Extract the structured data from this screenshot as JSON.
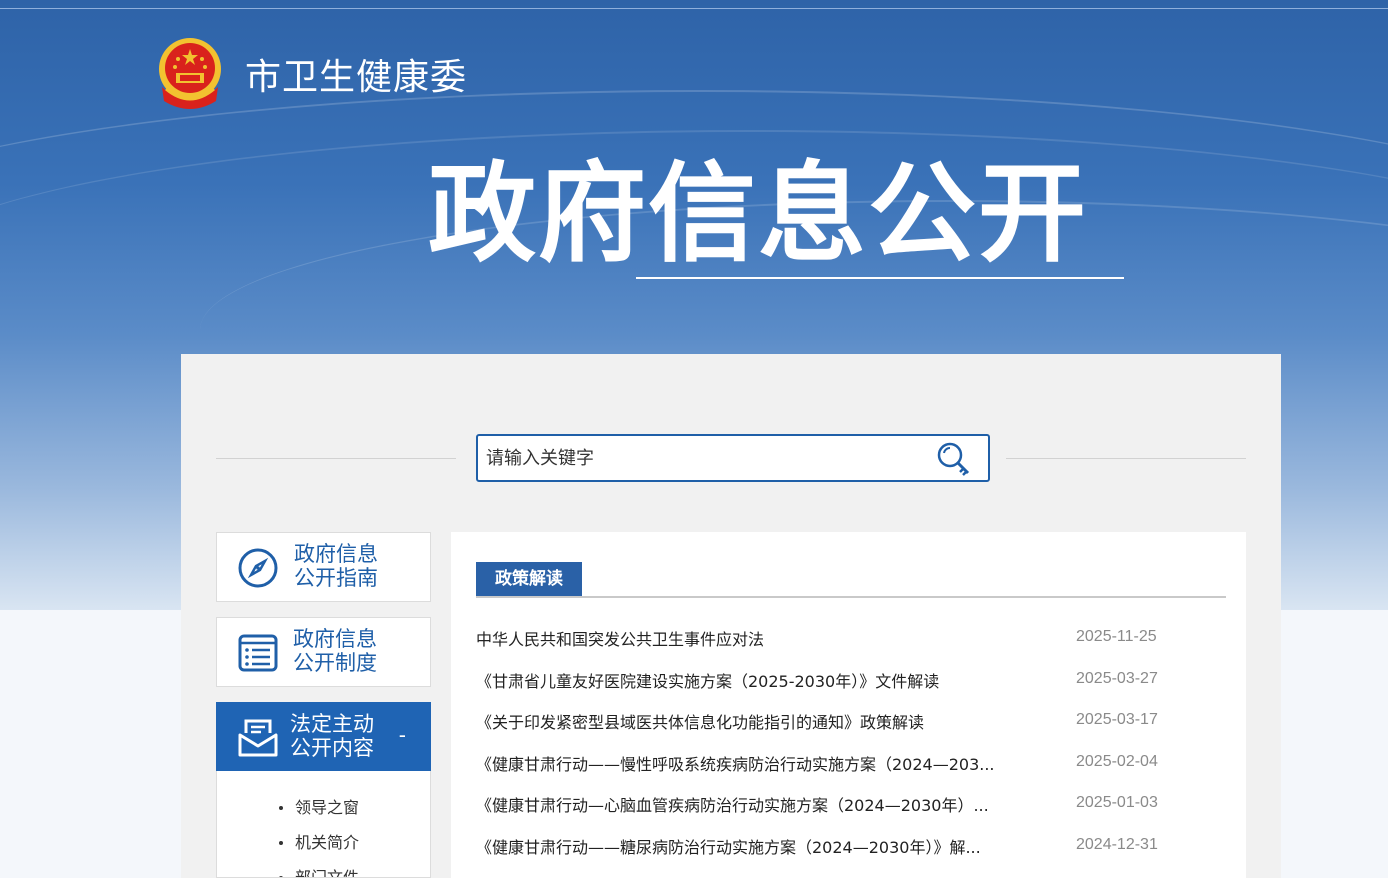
{
  "header": {
    "site_title": "市卫生健康委",
    "hero_title": "政府信息公开"
  },
  "search": {
    "placeholder": "请输入关键字"
  },
  "sidebar": {
    "items": [
      {
        "label_line1": "政府信息",
        "label_line2": "公开指南",
        "icon": "compass-icon"
      },
      {
        "label_line1": "政府信息",
        "label_line2": "公开制度",
        "icon": "document-list-icon"
      },
      {
        "label_line1": "法定主动",
        "label_line2": "公开内容",
        "icon": "mail-inbox-icon",
        "toggle": "-"
      }
    ],
    "subitems": [
      "领导之窗",
      "机关简介",
      "部门文件"
    ]
  },
  "content": {
    "section_title": "政策解读",
    "news": [
      {
        "title": "中华人民共和国突发公共卫生事件应对法",
        "date": "2025-11-25"
      },
      {
        "title": "《甘肃省儿童友好医院建设实施方案（2025-2030年）》文件解读",
        "date": "2025-03-27"
      },
      {
        "title": "《关于印发紧密型县域医共体信息化功能指引的通知》政策解读",
        "date": "2025-03-17"
      },
      {
        "title": "《健康甘肃行动——慢性呼吸系统疾病防治行动实施方案（2024—203...",
        "date": "2025-02-04"
      },
      {
        "title": "《健康甘肃行动—心脑血管疾病防治行动实施方案（2024—2030年）...",
        "date": "2025-01-03"
      },
      {
        "title": "《健康甘肃行动——糖尿病防治行动实施方案（2024—2030年）》解...",
        "date": "2024-12-31"
      }
    ]
  },
  "colors": {
    "primary_blue": "#1f64b4",
    "tab_blue": "#2a61a7",
    "emblem_red": "#d9221c",
    "emblem_gold": "#f2c230"
  }
}
